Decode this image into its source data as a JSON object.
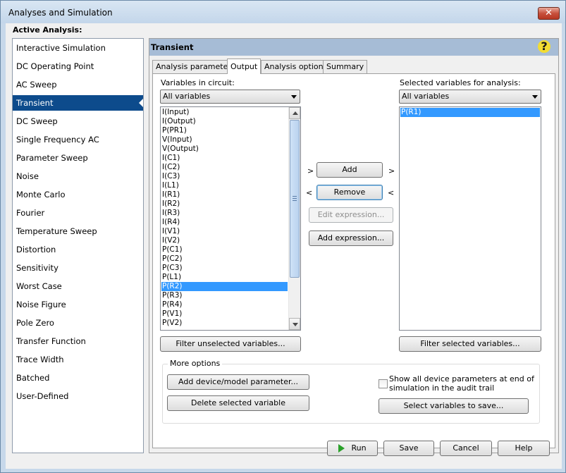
{
  "window": {
    "title": "Analyses and Simulation",
    "close_glyph": "✕"
  },
  "active_analysis_label": "Active Analysis:",
  "analyses": [
    "Interactive Simulation",
    "DC Operating Point",
    "AC Sweep",
    "Transient",
    "DC Sweep",
    "Single Frequency AC",
    "Parameter Sweep",
    "Noise",
    "Monte Carlo",
    "Fourier",
    "Temperature Sweep",
    "Distortion",
    "Sensitivity",
    "Worst Case",
    "Noise Figure",
    "Pole Zero",
    "Transfer Function",
    "Trace Width",
    "Batched",
    "User-Defined"
  ],
  "selected_analysis": "Transient",
  "panel": {
    "title": "Transient",
    "help_glyph": "?"
  },
  "tabs": [
    "Analysis parameters",
    "Output",
    "Analysis options",
    "Summary"
  ],
  "active_tab": "Output",
  "left": {
    "label": "Variables in circuit:",
    "filter_value": "All variables",
    "variables": [
      "I(Input)",
      "I(Output)",
      "P(PR1)",
      "V(Input)",
      "V(Output)",
      "I(C1)",
      "I(C2)",
      "I(C3)",
      "I(L1)",
      "I(R1)",
      "I(R2)",
      "I(R3)",
      "I(R4)",
      "I(V1)",
      "I(V2)",
      "P(C1)",
      "P(C2)",
      "P(C3)",
      "P(L1)",
      "P(R2)",
      "P(R3)",
      "P(R4)",
      "P(V1)",
      "P(V2)"
    ],
    "selected_variable": "P(R2)",
    "filter_button": "Filter unselected variables..."
  },
  "middle": {
    "add_left_arrow": ">",
    "add_right_arrow": ">",
    "remove_left_arrow": "<",
    "remove_right_arrow": "<",
    "add": "Add",
    "remove": "Remove",
    "edit_expression": "Edit expression...",
    "add_expression": "Add expression..."
  },
  "right": {
    "label": "Selected variables for analysis:",
    "filter_value": "All variables",
    "variables": [
      "P(R1)"
    ],
    "selected_variable": "P(R1)",
    "filter_button": "Filter selected variables..."
  },
  "more_options": {
    "title": "More options",
    "add_device_param": "Add device/model parameter...",
    "delete_variable": "Delete selected variable",
    "show_all_params_line1": "Show all device parameters at end of",
    "show_all_params_line2": "simulation in the audit trail",
    "show_all_params_checked": false,
    "select_vars_to_save": "Select variables to save..."
  },
  "footer": {
    "run": "Run",
    "save": "Save",
    "cancel": "Cancel",
    "help": "Help"
  },
  "colors": {
    "selection": "#0d4b8c",
    "list_selection": "#3399ff",
    "header": "#a6bcd6"
  }
}
